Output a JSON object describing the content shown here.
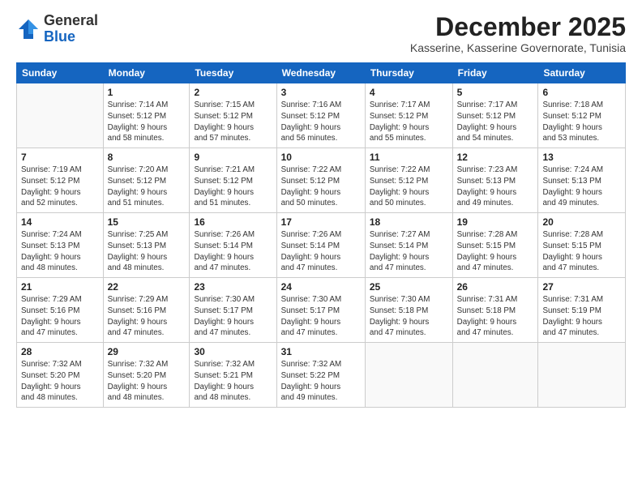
{
  "header": {
    "logo_general": "General",
    "logo_blue": "Blue",
    "month_title": "December 2025",
    "subtitle": "Kasserine, Kasserine Governorate, Tunisia"
  },
  "weekdays": [
    "Sunday",
    "Monday",
    "Tuesday",
    "Wednesday",
    "Thursday",
    "Friday",
    "Saturday"
  ],
  "weeks": [
    [
      {
        "day": "",
        "info": ""
      },
      {
        "day": "1",
        "info": "Sunrise: 7:14 AM\nSunset: 5:12 PM\nDaylight: 9 hours\nand 58 minutes."
      },
      {
        "day": "2",
        "info": "Sunrise: 7:15 AM\nSunset: 5:12 PM\nDaylight: 9 hours\nand 57 minutes."
      },
      {
        "day": "3",
        "info": "Sunrise: 7:16 AM\nSunset: 5:12 PM\nDaylight: 9 hours\nand 56 minutes."
      },
      {
        "day": "4",
        "info": "Sunrise: 7:17 AM\nSunset: 5:12 PM\nDaylight: 9 hours\nand 55 minutes."
      },
      {
        "day": "5",
        "info": "Sunrise: 7:17 AM\nSunset: 5:12 PM\nDaylight: 9 hours\nand 54 minutes."
      },
      {
        "day": "6",
        "info": "Sunrise: 7:18 AM\nSunset: 5:12 PM\nDaylight: 9 hours\nand 53 minutes."
      }
    ],
    [
      {
        "day": "7",
        "info": "Sunrise: 7:19 AM\nSunset: 5:12 PM\nDaylight: 9 hours\nand 52 minutes."
      },
      {
        "day": "8",
        "info": "Sunrise: 7:20 AM\nSunset: 5:12 PM\nDaylight: 9 hours\nand 51 minutes."
      },
      {
        "day": "9",
        "info": "Sunrise: 7:21 AM\nSunset: 5:12 PM\nDaylight: 9 hours\nand 51 minutes."
      },
      {
        "day": "10",
        "info": "Sunrise: 7:22 AM\nSunset: 5:12 PM\nDaylight: 9 hours\nand 50 minutes."
      },
      {
        "day": "11",
        "info": "Sunrise: 7:22 AM\nSunset: 5:12 PM\nDaylight: 9 hours\nand 50 minutes."
      },
      {
        "day": "12",
        "info": "Sunrise: 7:23 AM\nSunset: 5:13 PM\nDaylight: 9 hours\nand 49 minutes."
      },
      {
        "day": "13",
        "info": "Sunrise: 7:24 AM\nSunset: 5:13 PM\nDaylight: 9 hours\nand 49 minutes."
      }
    ],
    [
      {
        "day": "14",
        "info": "Sunrise: 7:24 AM\nSunset: 5:13 PM\nDaylight: 9 hours\nand 48 minutes."
      },
      {
        "day": "15",
        "info": "Sunrise: 7:25 AM\nSunset: 5:13 PM\nDaylight: 9 hours\nand 48 minutes."
      },
      {
        "day": "16",
        "info": "Sunrise: 7:26 AM\nSunset: 5:14 PM\nDaylight: 9 hours\nand 47 minutes."
      },
      {
        "day": "17",
        "info": "Sunrise: 7:26 AM\nSunset: 5:14 PM\nDaylight: 9 hours\nand 47 minutes."
      },
      {
        "day": "18",
        "info": "Sunrise: 7:27 AM\nSunset: 5:14 PM\nDaylight: 9 hours\nand 47 minutes."
      },
      {
        "day": "19",
        "info": "Sunrise: 7:28 AM\nSunset: 5:15 PM\nDaylight: 9 hours\nand 47 minutes."
      },
      {
        "day": "20",
        "info": "Sunrise: 7:28 AM\nSunset: 5:15 PM\nDaylight: 9 hours\nand 47 minutes."
      }
    ],
    [
      {
        "day": "21",
        "info": "Sunrise: 7:29 AM\nSunset: 5:16 PM\nDaylight: 9 hours\nand 47 minutes."
      },
      {
        "day": "22",
        "info": "Sunrise: 7:29 AM\nSunset: 5:16 PM\nDaylight: 9 hours\nand 47 minutes."
      },
      {
        "day": "23",
        "info": "Sunrise: 7:30 AM\nSunset: 5:17 PM\nDaylight: 9 hours\nand 47 minutes."
      },
      {
        "day": "24",
        "info": "Sunrise: 7:30 AM\nSunset: 5:17 PM\nDaylight: 9 hours\nand 47 minutes."
      },
      {
        "day": "25",
        "info": "Sunrise: 7:30 AM\nSunset: 5:18 PM\nDaylight: 9 hours\nand 47 minutes."
      },
      {
        "day": "26",
        "info": "Sunrise: 7:31 AM\nSunset: 5:18 PM\nDaylight: 9 hours\nand 47 minutes."
      },
      {
        "day": "27",
        "info": "Sunrise: 7:31 AM\nSunset: 5:19 PM\nDaylight: 9 hours\nand 47 minutes."
      }
    ],
    [
      {
        "day": "28",
        "info": "Sunrise: 7:32 AM\nSunset: 5:20 PM\nDaylight: 9 hours\nand 48 minutes."
      },
      {
        "day": "29",
        "info": "Sunrise: 7:32 AM\nSunset: 5:20 PM\nDaylight: 9 hours\nand 48 minutes."
      },
      {
        "day": "30",
        "info": "Sunrise: 7:32 AM\nSunset: 5:21 PM\nDaylight: 9 hours\nand 48 minutes."
      },
      {
        "day": "31",
        "info": "Sunrise: 7:32 AM\nSunset: 5:22 PM\nDaylight: 9 hours\nand 49 minutes."
      },
      {
        "day": "",
        "info": ""
      },
      {
        "day": "",
        "info": ""
      },
      {
        "day": "",
        "info": ""
      }
    ]
  ]
}
